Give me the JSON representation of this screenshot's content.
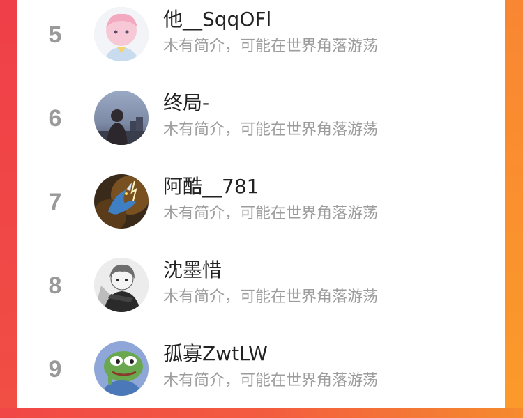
{
  "list": {
    "users": [
      {
        "rank": "5",
        "name": "他__SqqOFl",
        "bio": "木有简介，可能在世界角落游荡",
        "avatar_icon": "anime-boy-avatar"
      },
      {
        "rank": "6",
        "name": "终局-",
        "bio": "木有简介，可能在世界角落游荡",
        "avatar_icon": "silhouette-dusk-avatar"
      },
      {
        "rank": "7",
        "name": "阿酷__781",
        "bio": "木有简介，可能在世界角落游荡",
        "avatar_icon": "dragon-avatar"
      },
      {
        "rank": "8",
        "name": "沈墨惜",
        "bio": "木有简介，可能在世界角落游荡",
        "avatar_icon": "manga-boy-avatar"
      },
      {
        "rank": "9",
        "name": "孤寡ZwtLW",
        "bio": "木有简介，可能在世界角落游荡",
        "avatar_icon": "pepe-frog-avatar"
      }
    ]
  },
  "colors": {
    "rank": "#9a9a9a",
    "name": "#222222",
    "bio": "#9c9c9c",
    "frame_left": "#f14747",
    "frame_right": "#f58b2e"
  }
}
